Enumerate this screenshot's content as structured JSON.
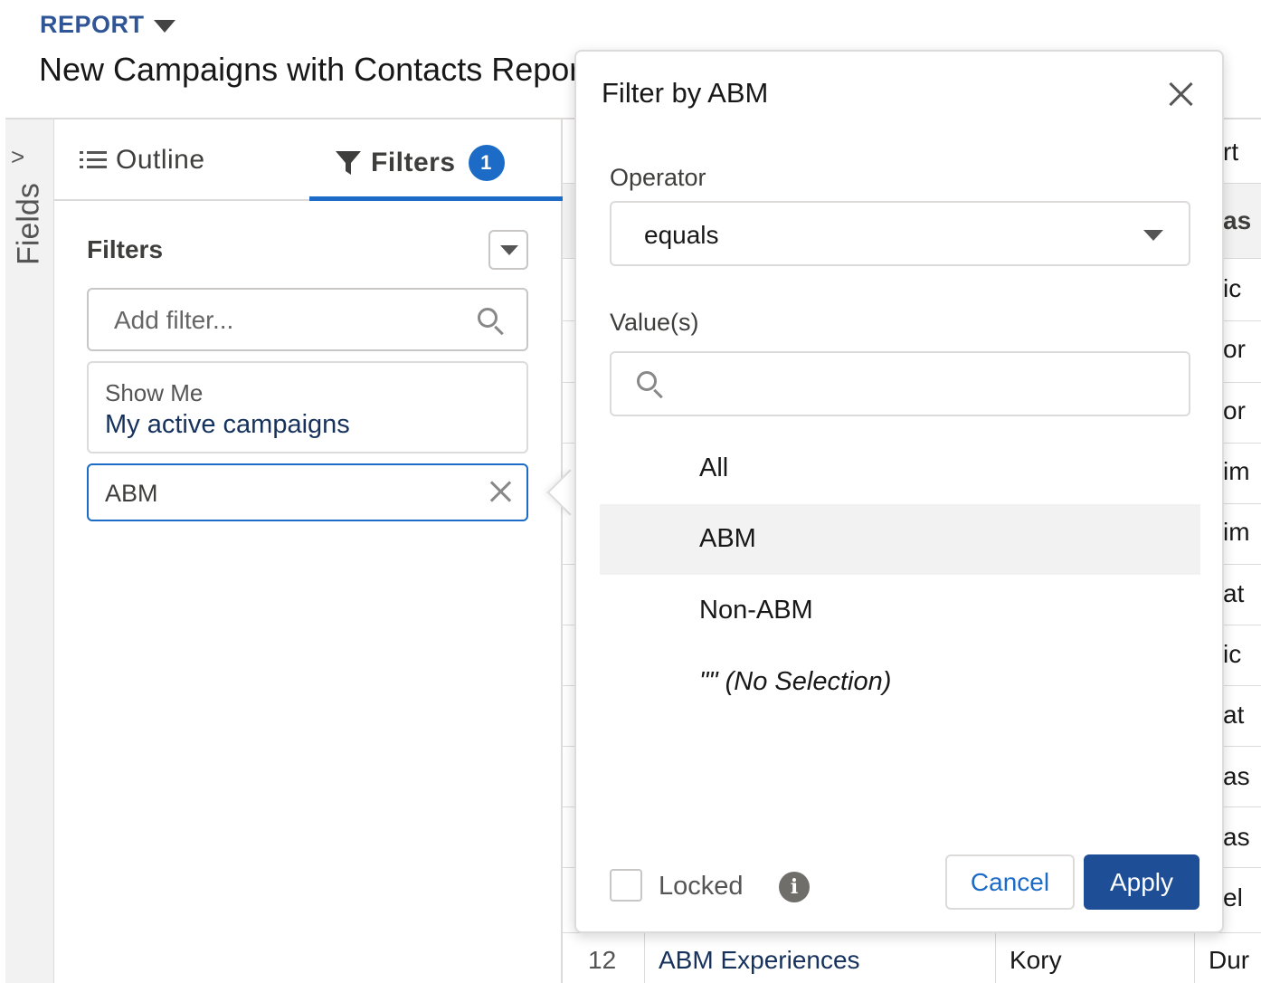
{
  "header": {
    "breadcrumb": "REPORT",
    "title": "New Campaigns with Contacts Report"
  },
  "fields_rail": {
    "label": "Fields"
  },
  "tabs": {
    "outline_label": "Outline",
    "filters_label": "Filters",
    "filters_count": "1"
  },
  "filters_panel": {
    "heading": "Filters",
    "add_filter_placeholder": "Add filter...",
    "show_me_label": "Show Me",
    "show_me_value": "My active campaigns",
    "active_filter": "ABM"
  },
  "popover": {
    "title": "Filter by ABM",
    "operator_label": "Operator",
    "operator_value": "equals",
    "values_label": "Value(s)",
    "options": [
      {
        "label": "All",
        "selected": false
      },
      {
        "label": "ABM",
        "selected": true
      },
      {
        "label": "Non-ABM",
        "selected": false
      },
      {
        "label": "\"\" (No Selection)",
        "selected": false
      }
    ],
    "locked_label": "Locked",
    "cancel_label": "Cancel",
    "apply_label": "Apply"
  },
  "table_edge": {
    "header_top": "rt",
    "header_col": "as",
    "cells": [
      "ic",
      "or",
      "or",
      "im",
      "im",
      "at",
      "ic",
      "at",
      "as",
      "as",
      "el"
    ],
    "last_row": {
      "num": "12",
      "name": "ABM Experiences",
      "owner": "Kory",
      "more": "Dur"
    }
  },
  "colors": {
    "brand_blue": "#1b6bc7",
    "apply_blue": "#1e4e96",
    "report_label": "#2f5597"
  }
}
